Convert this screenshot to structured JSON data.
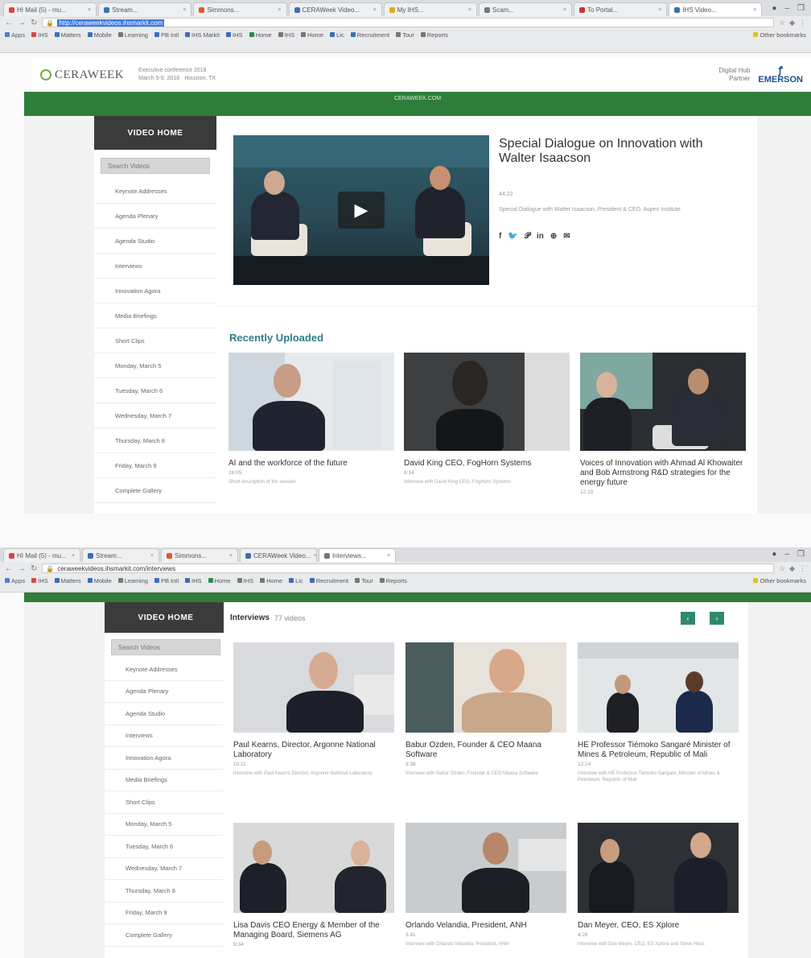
{
  "browser1": {
    "tabs": [
      "HI Mail (5) - mu...",
      "Stream...",
      "Simmons...",
      "CERAWeek Video...",
      "My IHS...",
      "Scam...",
      "To Portal...",
      "IHS Video..."
    ],
    "url_selected": "http://ceraweekvideos.ihsmarkit.com",
    "bookmarks": [
      "Apps",
      "IHS",
      "Matters",
      "Mobile",
      "Learning",
      "PB Intl",
      "IHS Markit",
      "IHS",
      "Home",
      "IHS",
      "Home",
      "Lic",
      "Recruitment",
      "Tour",
      "Reports",
      "Other bookmarks"
    ]
  },
  "browser2": {
    "tabs": [
      "HI Mail (5) - mu...",
      "Stream...",
      "Simmons...",
      "CERAWeek Video...",
      "Interviews..."
    ],
    "url": "ceraweekvideos.ihsmarkit.com/interviews",
    "bookmarks": [
      "Apps",
      "IHS",
      "Matters",
      "Mobile",
      "Learning",
      "PB Intl",
      "IHS",
      "Home",
      "IHS",
      "Home",
      "Lic",
      "Recruitment",
      "Tour",
      "Reports",
      "Other bookmarks"
    ]
  },
  "header": {
    "logo": "CERAWEEK",
    "tagline_1": "Executive conference 2018",
    "tagline_2": "March 5-9, 2018 · Houston, TX",
    "sponsor_by": "Digital Hub",
    "sponsor_by2": "Partner",
    "sponsor": "EMERSON"
  },
  "greenbar_text": "CERAWEEK.COM",
  "sidebar": {
    "title": "VIDEO HOME",
    "search_placeholder": "Search Videos",
    "items": [
      "Keynote Addresses",
      "Agenda Plenary",
      "Agenda Studio",
      "Interviews",
      "Innovation Agora",
      "Media Briefings",
      "Short Clips",
      "Monday, March 5",
      "Tuesday, March 6",
      "Wednesday, March 7",
      "Thursday, March 8",
      "Friday, March 9",
      "Complete Gallery"
    ]
  },
  "featured": {
    "title": "Special Dialogue on Innovation with Walter Isaacson",
    "duration": "44:22",
    "description": "Special Dialogue with Walter Isaacson, President & CEO, Aspen Institute",
    "share_icons": [
      "facebook-icon",
      "twitter-icon",
      "pinterest-icon",
      "linkedin-icon",
      "email-icon"
    ]
  },
  "recent": {
    "title": "Recently Uploaded",
    "items": [
      {
        "title": "AI and the workforce of the future",
        "duration": "26:05",
        "desc": "Short description of the session"
      },
      {
        "title": "David King CEO, FogHorn Systems",
        "duration": "6:14",
        "desc": "Interview with David King CEO, FogHorn Systems"
      },
      {
        "title": "Voices of Innovation with Ahmad Al Khowaiter and Bob Armstrong R&D strategies for the energy future",
        "duration": "12:10",
        "desc": ""
      }
    ]
  },
  "interviews": {
    "title": "Interviews",
    "count": "77 videos",
    "items": [
      {
        "title": "Paul Kearns, Director, Argonne National Laboratory",
        "duration": "10:11",
        "desc": "Interview with Paul Kearns Director, Argonne National Laboratory"
      },
      {
        "title": "Babur Ozden, Founder & CEO Maana Software",
        "duration": "3:38",
        "desc": "Interview with Babur Ozden, Founder & CEO Maana Software"
      },
      {
        "title": "HE Professor Tiémoko Sangaré Minister of Mines & Petroleum, Republic of Mali",
        "duration": "12:14",
        "desc": "Interview with HE Professor Tiémoko Sangaré, Minister of Mines & Petroleum, Republic of Mali"
      },
      {
        "title": "Lisa Davis CEO Energy & Member of the Managing Board, Siemens AG",
        "duration": "9:34",
        "desc": ""
      },
      {
        "title": "Orlando Velandia, President, ANH",
        "duration": "3:41",
        "desc": "Interview with Orlando Velandia, President, ANH"
      },
      {
        "title": "Dan Meyer, CEO, ES Xplore",
        "duration": "4:28",
        "desc": "Interview with Dan Meyer, CEO, ES Xplore and Steve Hess"
      }
    ]
  },
  "colors": {
    "green": "#2f7d3a",
    "teal": "#2f7d8a",
    "sidebar_head": "#3b3b3b"
  }
}
